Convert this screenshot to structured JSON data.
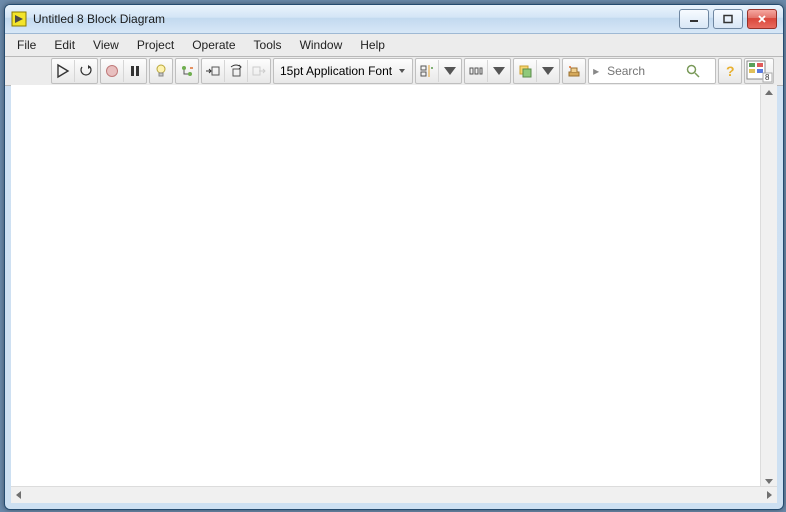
{
  "window": {
    "title": "Untitled 8 Block Diagram"
  },
  "menu": {
    "file": "File",
    "edit": "Edit",
    "view": "View",
    "project": "Project",
    "operate": "Operate",
    "tools": "Tools",
    "window": "Window",
    "help": "Help"
  },
  "toolbar": {
    "font_label": "15pt Application Font",
    "search_placeholder": "Search",
    "vi_badge": "8"
  },
  "icons": {
    "run": "run-arrow",
    "run_cont": "run-continuous",
    "abort": "abort",
    "pause": "pause",
    "highlight": "highlight-bulb",
    "probe": "retain-wire",
    "step_into": "step-into",
    "step_over": "step-over",
    "step_out": "step-out",
    "align": "align",
    "distribute": "distribute",
    "reorder": "reorder",
    "cleanup": "cleanup",
    "help": "context-help",
    "labview": "labview-vi"
  }
}
